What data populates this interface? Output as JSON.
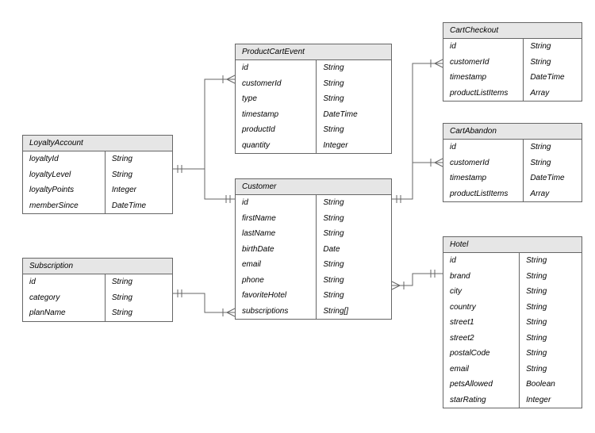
{
  "entities": {
    "loyaltyAccount": {
      "title": "LoyaltyAccount",
      "fields": [
        {
          "name": "loyaltyId",
          "type": "String"
        },
        {
          "name": "loyaltyLevel",
          "type": "String"
        },
        {
          "name": "loyaltyPoints",
          "type": "Integer"
        },
        {
          "name": "memberSince",
          "type": "DateTime"
        }
      ]
    },
    "subscription": {
      "title": "Subscription",
      "fields": [
        {
          "name": "id",
          "type": "String"
        },
        {
          "name": "category",
          "type": "String"
        },
        {
          "name": "planName",
          "type": "String"
        }
      ]
    },
    "productCartEvent": {
      "title": "ProductCartEvent",
      "fields": [
        {
          "name": "id",
          "type": "String"
        },
        {
          "name": "customerId",
          "type": "String"
        },
        {
          "name": "type",
          "type": "String"
        },
        {
          "name": "timestamp",
          "type": "DateTime"
        },
        {
          "name": "productId",
          "type": "String"
        },
        {
          "name": "quantity",
          "type": "Integer"
        }
      ]
    },
    "customer": {
      "title": "Customer",
      "fields": [
        {
          "name": "id",
          "type": "String"
        },
        {
          "name": "firstName",
          "type": "String"
        },
        {
          "name": "lastName",
          "type": "String"
        },
        {
          "name": "birthDate",
          "type": "Date"
        },
        {
          "name": "email",
          "type": "String"
        },
        {
          "name": "phone",
          "type": "String"
        },
        {
          "name": "favoriteHotel",
          "type": "String"
        },
        {
          "name": "subscriptions",
          "type": "String[]"
        }
      ]
    },
    "cartCheckout": {
      "title": "CartCheckout",
      "fields": [
        {
          "name": "id",
          "type": "String"
        },
        {
          "name": "customerId",
          "type": "String"
        },
        {
          "name": "timestamp",
          "type": "DateTime"
        },
        {
          "name": "productListItems",
          "type": "Array"
        }
      ]
    },
    "cartAbandon": {
      "title": "CartAbandon",
      "fields": [
        {
          "name": "id",
          "type": "String"
        },
        {
          "name": "customerId",
          "type": "String"
        },
        {
          "name": "timestamp",
          "type": "DateTime"
        },
        {
          "name": "productListItems",
          "type": "Array"
        }
      ]
    },
    "hotel": {
      "title": "Hotel",
      "fields": [
        {
          "name": "id",
          "type": "String"
        },
        {
          "name": "brand",
          "type": "String"
        },
        {
          "name": "city",
          "type": "String"
        },
        {
          "name": "country",
          "type": "String"
        },
        {
          "name": "street1",
          "type": "String"
        },
        {
          "name": "street2",
          "type": "String"
        },
        {
          "name": "postalCode",
          "type": "String"
        },
        {
          "name": "email",
          "type": "String"
        },
        {
          "name": "petsAllowed",
          "type": "Boolean"
        },
        {
          "name": "starRating",
          "type": "Integer"
        }
      ]
    }
  },
  "relationships": [
    {
      "from": "Customer",
      "to": "LoyaltyAccount",
      "type": "one-to-one"
    },
    {
      "from": "Customer",
      "to": "Subscription",
      "type": "one-to-many"
    },
    {
      "from": "Customer",
      "to": "ProductCartEvent",
      "type": "one-to-many"
    },
    {
      "from": "Customer",
      "to": "CartCheckout",
      "type": "one-to-many"
    },
    {
      "from": "Customer",
      "to": "CartAbandon",
      "type": "one-to-many"
    },
    {
      "from": "Customer",
      "to": "Hotel",
      "type": "many-to-one"
    }
  ]
}
